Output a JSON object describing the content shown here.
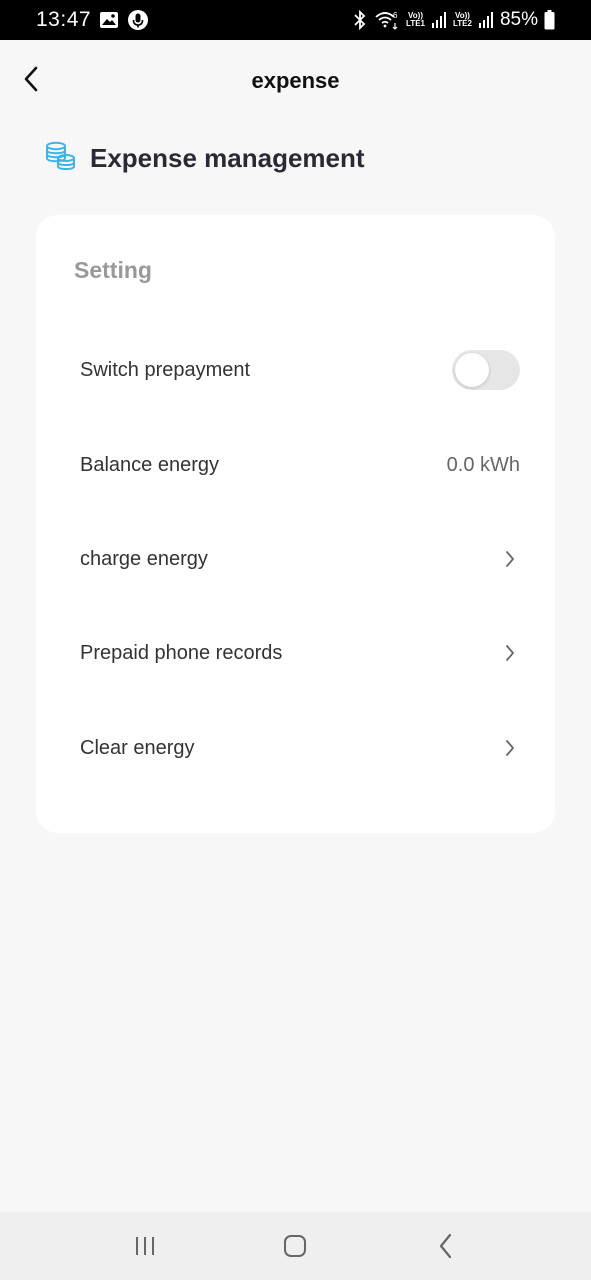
{
  "status_bar": {
    "time": "13:47",
    "battery": "85%",
    "net1_top": "Vo))",
    "net1_bottom": "LTE1",
    "net2_top": "Vo))",
    "net2_bottom": "LTE2",
    "wifi_badge": "6",
    "icons": [
      "image-icon",
      "mic-icon",
      "bluetooth-icon",
      "wifi-icon",
      "signal-icon",
      "battery-icon"
    ]
  },
  "header": {
    "title": "expense",
    "back_icon": "back-arrow-icon"
  },
  "section": {
    "title": "Expense management",
    "icon": "coins-icon",
    "icon_color": "#3cb4e6"
  },
  "card": {
    "heading": "Setting",
    "rows": [
      {
        "label": "Switch prepayment",
        "control": "toggle",
        "on": false
      },
      {
        "label": "Balance energy",
        "value": "0.0 kWh"
      },
      {
        "label": "charge energy",
        "control": "chevron"
      },
      {
        "label": "Prepaid phone records",
        "control": "chevron"
      },
      {
        "label": "Clear energy",
        "control": "chevron"
      }
    ]
  },
  "nav_bar": {
    "buttons": [
      "recent-apps-icon",
      "home-icon",
      "back-icon"
    ]
  }
}
